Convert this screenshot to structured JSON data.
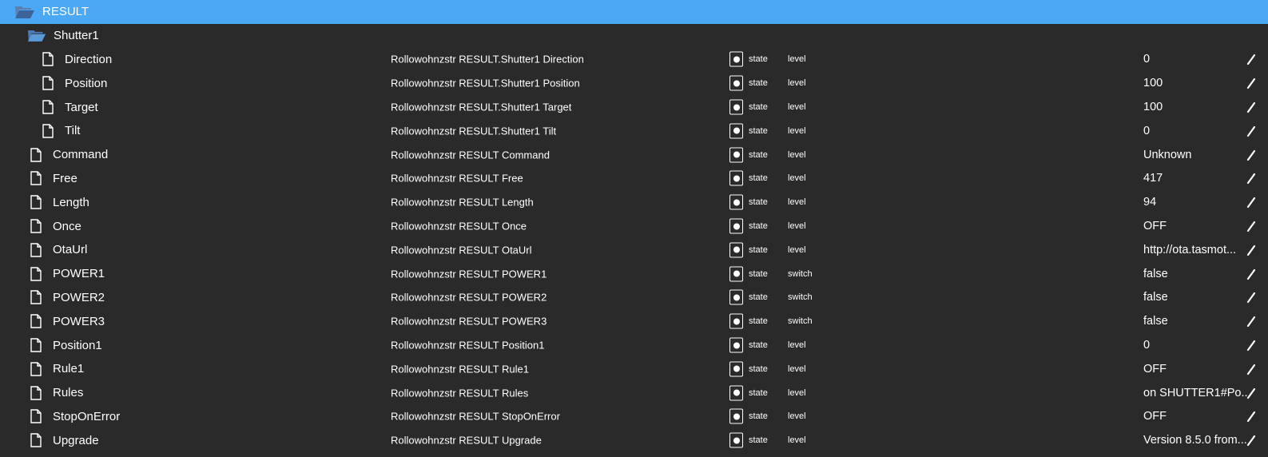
{
  "root": {
    "label": "RESULT",
    "icon": "folder-open-icon"
  },
  "shutter": {
    "label": "Shutter1",
    "icon": "folder-open-icon"
  },
  "rows": [
    {
      "name": "Direction",
      "indent": 2,
      "desc": "Rollowohnzstr RESULT.Shutter1 Direction",
      "type": "state",
      "role": "level",
      "value": "0"
    },
    {
      "name": "Position",
      "indent": 2,
      "desc": "Rollowohnzstr RESULT.Shutter1 Position",
      "type": "state",
      "role": "level",
      "value": "100"
    },
    {
      "name": "Target",
      "indent": 2,
      "desc": "Rollowohnzstr RESULT.Shutter1 Target",
      "type": "state",
      "role": "level",
      "value": "100"
    },
    {
      "name": "Tilt",
      "indent": 2,
      "desc": "Rollowohnzstr RESULT.Shutter1 Tilt",
      "type": "state",
      "role": "level",
      "value": "0"
    },
    {
      "name": "Command",
      "indent": 1,
      "desc": "Rollowohnzstr RESULT Command",
      "type": "state",
      "role": "level",
      "value": "Unknown"
    },
    {
      "name": "Free",
      "indent": 1,
      "desc": "Rollowohnzstr RESULT Free",
      "type": "state",
      "role": "level",
      "value": "417"
    },
    {
      "name": "Length",
      "indent": 1,
      "desc": "Rollowohnzstr RESULT Length",
      "type": "state",
      "role": "level",
      "value": "94"
    },
    {
      "name": "Once",
      "indent": 1,
      "desc": "Rollowohnzstr RESULT Once",
      "type": "state",
      "role": "level",
      "value": "OFF"
    },
    {
      "name": "OtaUrl",
      "indent": 1,
      "desc": "Rollowohnzstr RESULT OtaUrl",
      "type": "state",
      "role": "level",
      "value": "http://ota.tasmot..."
    },
    {
      "name": "POWER1",
      "indent": 1,
      "desc": "Rollowohnzstr RESULT POWER1",
      "type": "state",
      "role": "switch",
      "value": "false"
    },
    {
      "name": "POWER2",
      "indent": 1,
      "desc": "Rollowohnzstr RESULT POWER2",
      "type": "state",
      "role": "switch",
      "value": "false"
    },
    {
      "name": "POWER3",
      "indent": 1,
      "desc": "Rollowohnzstr RESULT POWER3",
      "type": "state",
      "role": "switch",
      "value": "false"
    },
    {
      "name": "Position1",
      "indent": 1,
      "desc": "Rollowohnzstr RESULT Position1",
      "type": "state",
      "role": "level",
      "value": "0"
    },
    {
      "name": "Rule1",
      "indent": 1,
      "desc": "Rollowohnzstr RESULT Rule1",
      "type": "state",
      "role": "level",
      "value": "OFF"
    },
    {
      "name": "Rules",
      "indent": 1,
      "desc": "Rollowohnzstr RESULT Rules",
      "type": "state",
      "role": "level",
      "value": "on SHUTTER1#Po..."
    },
    {
      "name": "StopOnError",
      "indent": 1,
      "desc": "Rollowohnzstr RESULT StopOnError",
      "type": "state",
      "role": "level",
      "value": "OFF"
    },
    {
      "name": "Upgrade",
      "indent": 1,
      "desc": "Rollowohnzstr RESULT Upgrade",
      "type": "state",
      "role": "level",
      "value": "Version 8.5.0 from..."
    }
  ],
  "colors": {
    "header_bg": "#4aa8f5",
    "body_bg": "#2a2a2a",
    "folder": "#5b9bd5",
    "text": "#ffffff"
  }
}
